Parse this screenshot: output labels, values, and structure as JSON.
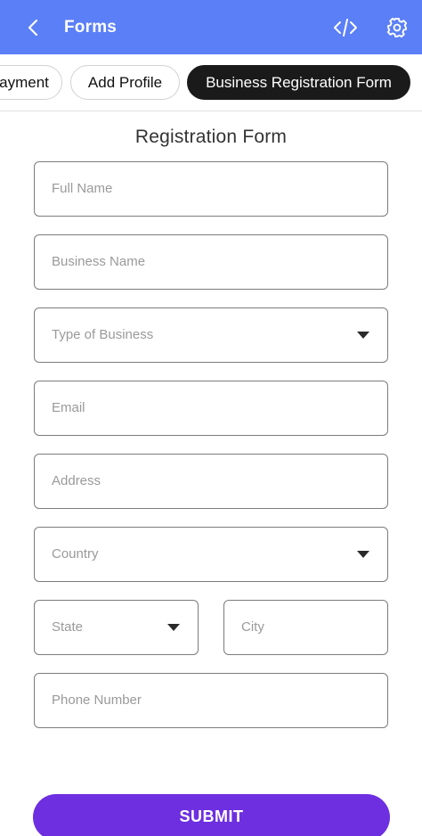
{
  "header": {
    "title": "Forms",
    "back_icon": "chevron-left-icon",
    "code_icon": "code-icon",
    "settings_icon": "gear-icon"
  },
  "tabs": [
    {
      "label": "Payment",
      "visible_text": "ayment",
      "active": false
    },
    {
      "label": "Add Profile",
      "active": false
    },
    {
      "label": "Business Registration Form",
      "active": true
    }
  ],
  "form": {
    "title": "Registration Form",
    "fields": {
      "full_name": {
        "placeholder": "Full Name",
        "value": ""
      },
      "business_name": {
        "placeholder": "Business Name",
        "value": ""
      },
      "type_of_business": {
        "placeholder": "Type of Business",
        "type": "select",
        "value": ""
      },
      "email": {
        "placeholder": "Email",
        "value": ""
      },
      "address": {
        "placeholder": "Address",
        "value": ""
      },
      "country": {
        "placeholder": "Country",
        "type": "select",
        "value": ""
      },
      "state": {
        "placeholder": "State",
        "type": "select",
        "value": ""
      },
      "city": {
        "placeholder": "City",
        "value": ""
      },
      "phone_number": {
        "placeholder": "Phone Number",
        "value": ""
      }
    },
    "submit_label": "SUBMIT"
  },
  "colors": {
    "header_bg": "#5b7ff6",
    "active_tab_bg": "#1a1a1a",
    "submit_bg": "#6d2fe0"
  }
}
